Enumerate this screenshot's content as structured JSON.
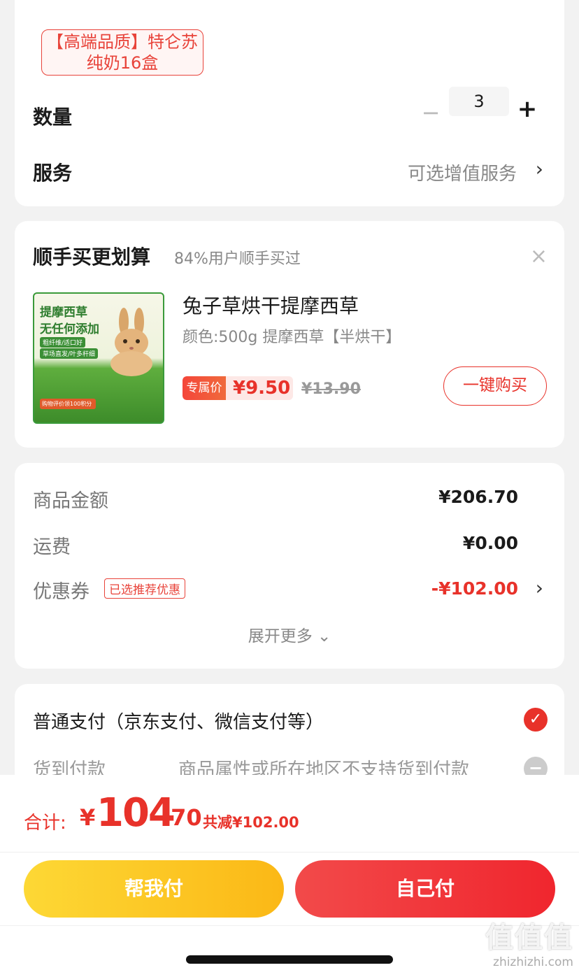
{
  "spec": {
    "option_line1": "【高端品质】特仑苏",
    "option_line2": "纯奶16盒"
  },
  "quantity": {
    "label": "数量",
    "minus": "−",
    "value": "3",
    "plus": "+"
  },
  "service": {
    "label": "服务",
    "value": "可选增值服务",
    "chevron": "›"
  },
  "bundle": {
    "title": "顺手买更划算",
    "subtitle": "84%用户顺手买过",
    "close": "×",
    "product": {
      "image_text1": "提摩西草",
      "image_text2": "无任何添加",
      "image_tag1": "粗纤维/适口好",
      "image_tag2": "草场直发/叶多杆细",
      "image_promo": "购物评价领100积分",
      "name": "兔子草烘干提摩西草",
      "spec": "颜色:500g 提摩西草【半烘干】",
      "price_badge": "专属价",
      "price": "¥9.50",
      "original_price": "¥13.90",
      "buy_button": "一键购买"
    }
  },
  "summary": {
    "goods_label": "商品金额",
    "goods_value": "¥206.70",
    "shipping_label": "运费",
    "shipping_value": "¥0.00",
    "coupon_label": "优惠券",
    "coupon_badge": "已选推荐优惠",
    "coupon_value": "-¥102.00",
    "coupon_chevron": "›",
    "expand_more": "展开更多 ⌄"
  },
  "payment": {
    "normal": "普通支付（京东支付、微信支付等）",
    "normal_check": "✓",
    "cod": "货到付款",
    "cod_note": "商品属性或所在地区不支持货到付款",
    "cod_icon": "−"
  },
  "bottom": {
    "total_label": "合计:",
    "total_currency": "¥",
    "total_int": "104",
    "total_dec": ".70",
    "total_discount": "共减¥102.00",
    "help_pay": "帮我付",
    "self_pay": "自己付"
  },
  "watermark": {
    "logo": "值值值",
    "url": "zhizhizhi.com"
  },
  "colors": {
    "accent": "#e8322a",
    "yellow_button": "#fbb816",
    "red_button": "#f0262e"
  }
}
